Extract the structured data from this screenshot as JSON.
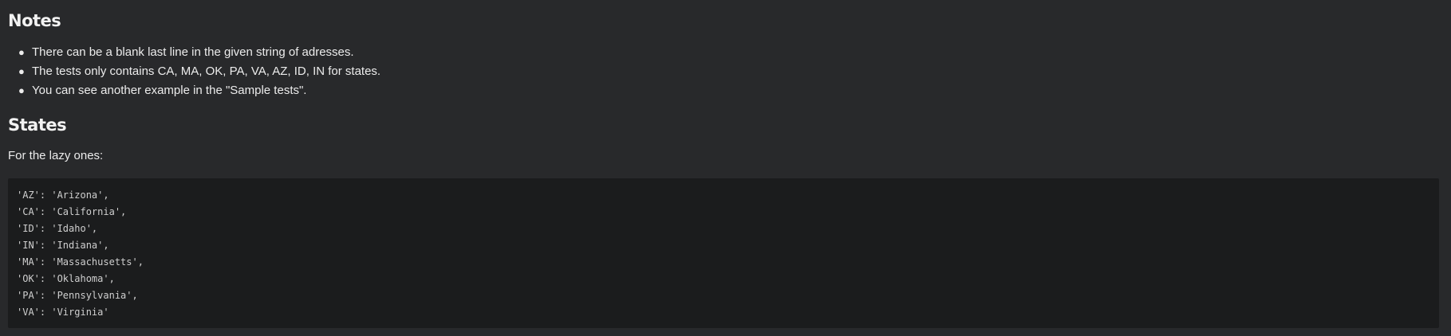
{
  "notes": {
    "heading": "Notes",
    "items": [
      "There can be a blank last line in the given string of adresses.",
      "The tests only contains CA, MA, OK, PA, VA, AZ, ID, IN for states.",
      "You can see another example in the \"Sample tests\"."
    ]
  },
  "states": {
    "heading": "States",
    "intro": "For the lazy ones:",
    "code_lines": [
      "'AZ': 'Arizona',",
      "'CA': 'California',",
      "'ID': 'Idaho',",
      "'IN': 'Indiana',",
      "'MA': 'Massachusetts',",
      "'OK': 'Oklahoma',",
      "'PA': 'Pennsylvania',",
      "'VA': 'Virginia'"
    ]
  },
  "colors": {
    "background": "#28292b",
    "code_background": "#1b1c1d",
    "text": "#ececec"
  }
}
